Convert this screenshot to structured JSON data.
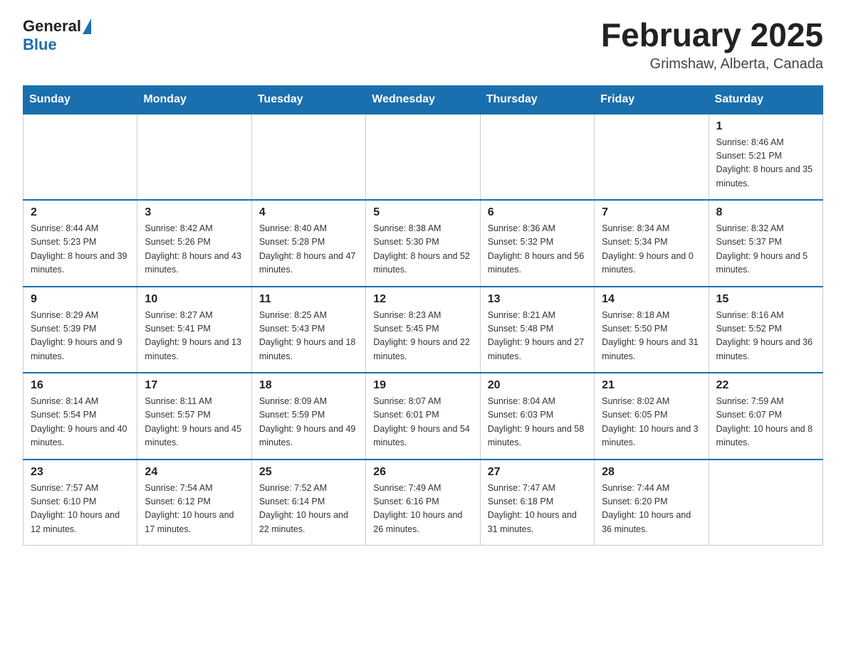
{
  "header": {
    "logo_general": "General",
    "logo_blue": "Blue",
    "month_title": "February 2025",
    "location": "Grimshaw, Alberta, Canada"
  },
  "days_of_week": [
    "Sunday",
    "Monday",
    "Tuesday",
    "Wednesday",
    "Thursday",
    "Friday",
    "Saturday"
  ],
  "weeks": [
    [
      {
        "day": "",
        "info": ""
      },
      {
        "day": "",
        "info": ""
      },
      {
        "day": "",
        "info": ""
      },
      {
        "day": "",
        "info": ""
      },
      {
        "day": "",
        "info": ""
      },
      {
        "day": "",
        "info": ""
      },
      {
        "day": "1",
        "info": "Sunrise: 8:46 AM\nSunset: 5:21 PM\nDaylight: 8 hours and 35 minutes."
      }
    ],
    [
      {
        "day": "2",
        "info": "Sunrise: 8:44 AM\nSunset: 5:23 PM\nDaylight: 8 hours and 39 minutes."
      },
      {
        "day": "3",
        "info": "Sunrise: 8:42 AM\nSunset: 5:26 PM\nDaylight: 8 hours and 43 minutes."
      },
      {
        "day": "4",
        "info": "Sunrise: 8:40 AM\nSunset: 5:28 PM\nDaylight: 8 hours and 47 minutes."
      },
      {
        "day": "5",
        "info": "Sunrise: 8:38 AM\nSunset: 5:30 PM\nDaylight: 8 hours and 52 minutes."
      },
      {
        "day": "6",
        "info": "Sunrise: 8:36 AM\nSunset: 5:32 PM\nDaylight: 8 hours and 56 minutes."
      },
      {
        "day": "7",
        "info": "Sunrise: 8:34 AM\nSunset: 5:34 PM\nDaylight: 9 hours and 0 minutes."
      },
      {
        "day": "8",
        "info": "Sunrise: 8:32 AM\nSunset: 5:37 PM\nDaylight: 9 hours and 5 minutes."
      }
    ],
    [
      {
        "day": "9",
        "info": "Sunrise: 8:29 AM\nSunset: 5:39 PM\nDaylight: 9 hours and 9 minutes."
      },
      {
        "day": "10",
        "info": "Sunrise: 8:27 AM\nSunset: 5:41 PM\nDaylight: 9 hours and 13 minutes."
      },
      {
        "day": "11",
        "info": "Sunrise: 8:25 AM\nSunset: 5:43 PM\nDaylight: 9 hours and 18 minutes."
      },
      {
        "day": "12",
        "info": "Sunrise: 8:23 AM\nSunset: 5:45 PM\nDaylight: 9 hours and 22 minutes."
      },
      {
        "day": "13",
        "info": "Sunrise: 8:21 AM\nSunset: 5:48 PM\nDaylight: 9 hours and 27 minutes."
      },
      {
        "day": "14",
        "info": "Sunrise: 8:18 AM\nSunset: 5:50 PM\nDaylight: 9 hours and 31 minutes."
      },
      {
        "day": "15",
        "info": "Sunrise: 8:16 AM\nSunset: 5:52 PM\nDaylight: 9 hours and 36 minutes."
      }
    ],
    [
      {
        "day": "16",
        "info": "Sunrise: 8:14 AM\nSunset: 5:54 PM\nDaylight: 9 hours and 40 minutes."
      },
      {
        "day": "17",
        "info": "Sunrise: 8:11 AM\nSunset: 5:57 PM\nDaylight: 9 hours and 45 minutes."
      },
      {
        "day": "18",
        "info": "Sunrise: 8:09 AM\nSunset: 5:59 PM\nDaylight: 9 hours and 49 minutes."
      },
      {
        "day": "19",
        "info": "Sunrise: 8:07 AM\nSunset: 6:01 PM\nDaylight: 9 hours and 54 minutes."
      },
      {
        "day": "20",
        "info": "Sunrise: 8:04 AM\nSunset: 6:03 PM\nDaylight: 9 hours and 58 minutes."
      },
      {
        "day": "21",
        "info": "Sunrise: 8:02 AM\nSunset: 6:05 PM\nDaylight: 10 hours and 3 minutes."
      },
      {
        "day": "22",
        "info": "Sunrise: 7:59 AM\nSunset: 6:07 PM\nDaylight: 10 hours and 8 minutes."
      }
    ],
    [
      {
        "day": "23",
        "info": "Sunrise: 7:57 AM\nSunset: 6:10 PM\nDaylight: 10 hours and 12 minutes."
      },
      {
        "day": "24",
        "info": "Sunrise: 7:54 AM\nSunset: 6:12 PM\nDaylight: 10 hours and 17 minutes."
      },
      {
        "day": "25",
        "info": "Sunrise: 7:52 AM\nSunset: 6:14 PM\nDaylight: 10 hours and 22 minutes."
      },
      {
        "day": "26",
        "info": "Sunrise: 7:49 AM\nSunset: 6:16 PM\nDaylight: 10 hours and 26 minutes."
      },
      {
        "day": "27",
        "info": "Sunrise: 7:47 AM\nSunset: 6:18 PM\nDaylight: 10 hours and 31 minutes."
      },
      {
        "day": "28",
        "info": "Sunrise: 7:44 AM\nSunset: 6:20 PM\nDaylight: 10 hours and 36 minutes."
      },
      {
        "day": "",
        "info": ""
      }
    ]
  ]
}
